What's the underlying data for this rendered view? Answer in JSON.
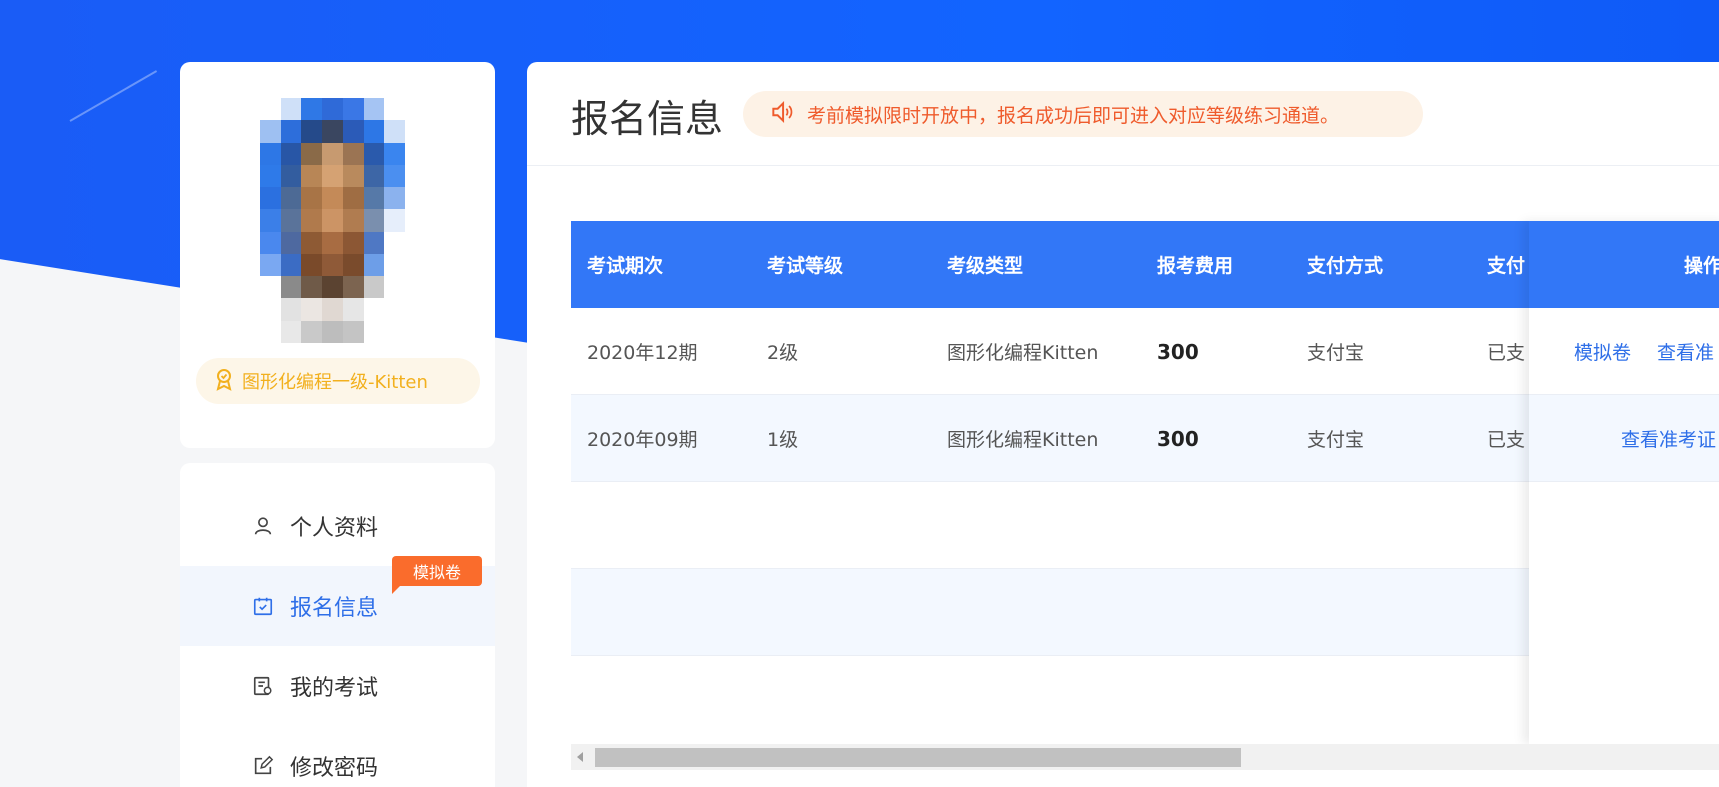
{
  "profile": {
    "badge_text": "图形化编程一级-Kitten",
    "avatar_pixels": [
      [
        "#ffffff",
        "#cfe0f8",
        "#2f78e6",
        "#2f6ad8",
        "#3a77e6",
        "#a5c4f3",
        "#ffffff"
      ],
      [
        "#9ec0f2",
        "#2d6edb",
        "#254a8a",
        "#3a4660",
        "#2b5bb8",
        "#2d77e6",
        "#cfe0f8"
      ],
      [
        "#2d77e6",
        "#2856a6",
        "#8a6a48",
        "#c79a70",
        "#9b7453",
        "#2a5aac",
        "#3a85ef"
      ],
      [
        "#2e7ae9",
        "#335d9f",
        "#b88656",
        "#d5a273",
        "#b98a5d",
        "#3d66a6",
        "#4b8ff0"
      ],
      [
        "#2b70e0",
        "#4d6a95",
        "#a87446",
        "#c48a58",
        "#9f6d43",
        "#5679a8",
        "#8bb2ee"
      ],
      [
        "#3b7fe8",
        "#5a739a",
        "#b07a4c",
        "#cc9465",
        "#b07c50",
        "#7a8fae",
        "#e6eefb"
      ],
      [
        "#4a88ee",
        "#4e69a0",
        "#8e5a34",
        "#a86c42",
        "#8c5734",
        "#4f78c4",
        "#ffffff"
      ],
      [
        "#7aa8f2",
        "#3b6cc4",
        "#7a4a2a",
        "#8f5a38",
        "#7a4b2c",
        "#6d9ee8",
        "#ffffff"
      ],
      [
        "#ffffff",
        "#8a8a8a",
        "#6f5a48",
        "#5b4331",
        "#7c6450",
        "#c9c9c9",
        "#ffffff"
      ],
      [
        "#ffffff",
        "#e2e2e2",
        "#ebe6e2",
        "#e0d8d2",
        "#e6e6e6",
        "#ffffff",
        "#ffffff"
      ],
      [
        "#ffffff",
        "#e8e8e8",
        "#c9c9c9",
        "#bdbdbd",
        "#c4c4c4",
        "#ffffff",
        "#ffffff"
      ]
    ]
  },
  "menu": {
    "items": [
      {
        "label": "个人资料",
        "icon": "user-icon"
      },
      {
        "label": "报名信息",
        "icon": "calendar-check-icon",
        "active": true
      },
      {
        "label": "我的考试",
        "icon": "exam-list-icon"
      },
      {
        "label": "修改密码",
        "icon": "edit-icon"
      }
    ],
    "mock_tag": "模拟卷"
  },
  "main": {
    "title": "报名信息",
    "notice": "考前模拟限时开放中，报名成功后即可进入对应等级练习通道。"
  },
  "table": {
    "headers": [
      "考试期次",
      "考试等级",
      "考级类型",
      "报考费用",
      "支付方式",
      "支付",
      "操作"
    ],
    "rows": [
      {
        "period": "2020年12期",
        "level": "2级",
        "type": "图形化编程Kitten",
        "fee": "300",
        "payment": "支付宝",
        "status": "已支",
        "ops": [
          "模拟卷",
          "查看准"
        ]
      },
      {
        "period": "2020年09期",
        "level": "1级",
        "type": "图形化编程Kitten",
        "fee": "300",
        "payment": "支付宝",
        "status": "已支",
        "ops": [
          "查看准考证"
        ]
      }
    ]
  },
  "colors": {
    "brand_blue": "#1264ff",
    "table_header": "#3277f7",
    "link": "#2f6fe8",
    "badge_gold": "#f2b01e",
    "notice_red": "#ef5b2c",
    "tag_orange": "#fa6c2c"
  }
}
